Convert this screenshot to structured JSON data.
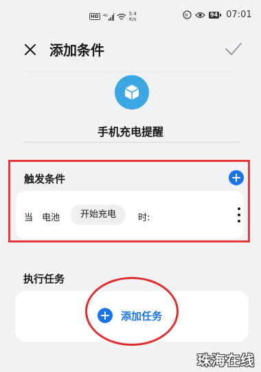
{
  "status_bar": {
    "hd": "HD",
    "network": "4G",
    "speed_value": "5.4",
    "speed_unit": "K/s",
    "battery": "94",
    "time": "07:01"
  },
  "header": {
    "title": "添加条件"
  },
  "scene": {
    "name": "手机充电提醒",
    "icon": "cube-icon"
  },
  "trigger": {
    "title": "触发条件",
    "condition": {
      "prefix": "当",
      "device": "电池",
      "state": "开始充电",
      "suffix": "时:"
    }
  },
  "task": {
    "title": "执行任务",
    "add_label": "添加任务"
  },
  "watermark": "珠海在线",
  "colors": {
    "accent": "#1a73e8",
    "scene_icon_bg": "#3ba8e4",
    "highlight_red": "#e53a3a",
    "background": "#f1f2f4"
  }
}
